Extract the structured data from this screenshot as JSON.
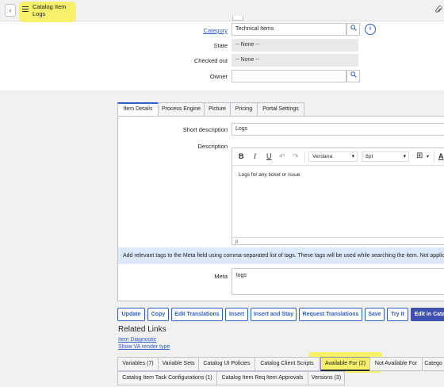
{
  "header": {
    "title_line1": "Catalog Item",
    "title_line2": "Logs",
    "back_icon": "chevron-left-icon",
    "menu_icon": "hamburger-icon",
    "attach_icon": "paperclip-icon"
  },
  "form": {
    "category": {
      "label": "Category",
      "value": "Technical Items"
    },
    "state": {
      "label": "State",
      "value": "-- None --"
    },
    "checked_out": {
      "label": "Checked out",
      "value": "-- None --"
    },
    "owner": {
      "label": "Owner",
      "value": ""
    }
  },
  "tabs": [
    "Item Details",
    "Process Engine",
    "Picture",
    "Pricing",
    "Portal Settings"
  ],
  "item_details": {
    "short_description_label": "Short description",
    "short_description_value": "Logs",
    "description_label": "Description",
    "editor": {
      "bold": "B",
      "italic": "I",
      "underline": "U",
      "font": "Verdana",
      "size": "8pt",
      "body": "Logs for any ticket or issue",
      "footer": "p"
    },
    "info_message": "Add relevant tags to the Meta field using comma-separated list of tags. These tags will be used while searching the item. Not applic",
    "meta_label": "Meta",
    "meta_value": "logs"
  },
  "buttons": [
    "Update",
    "Copy",
    "Edit Translations",
    "Insert",
    "Insert and Stay",
    "Request Translations",
    "Save",
    "Try It",
    "Edit in Cata"
  ],
  "related": {
    "title": "Related Links",
    "links": [
      "Item Diagnostic",
      "Show VA render type"
    ]
  },
  "related_tabs_row1": [
    "Variables (7)",
    "Variable Sets",
    "Catalog UI Policies",
    "Catalog Client Scripts",
    "Available For (2)",
    "Not Available For",
    "Catego"
  ],
  "related_tabs_row2": [
    "Catalog Item Task Configurations (1)",
    "Catalog Item Req Item Approvals",
    "Versions (3)"
  ],
  "colors": {
    "accent": "#2f5ec4",
    "primary_button": "#3e4fb1",
    "highlight": "#f6f06a",
    "info_bar": "#dbe9f8"
  }
}
